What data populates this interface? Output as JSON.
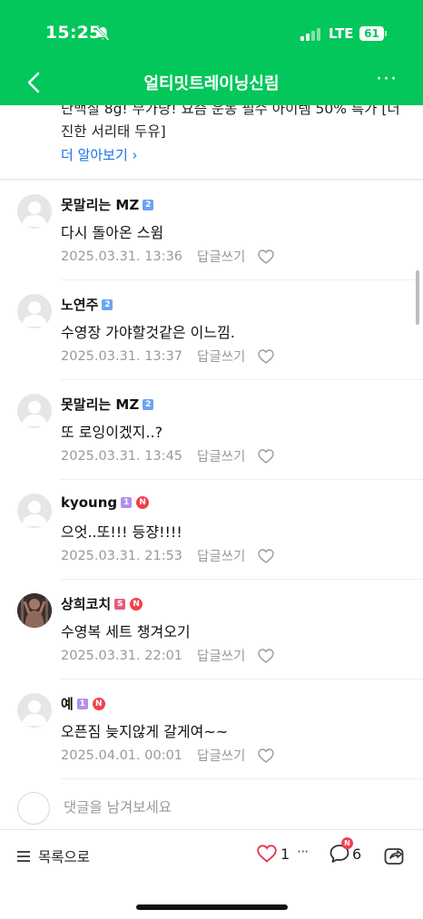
{
  "status_bar": {
    "time": "15:25",
    "network": "LTE",
    "battery": "61"
  },
  "nav": {
    "title": "얼티밋트레이닝신림"
  },
  "ad": {
    "text": "단백질 8g! 무가당! 요즘 운동 필수 아이템 50% 특가 [더 진한 서리태 두유]",
    "link": "더 알아보기 ›"
  },
  "comments": [
    {
      "author": "못말리는 MZ",
      "level": "2",
      "level_color": "#6ba3f5",
      "new": false,
      "text": "다시 돌아온 스윔",
      "date": "2025.03.31. 13:36",
      "reply": "답글쓰기",
      "photo": false
    },
    {
      "author": "노연주",
      "level": "2",
      "level_color": "#6ba3f5",
      "new": false,
      "text": "수영장 가야할것같은 이느낌.",
      "date": "2025.03.31. 13:37",
      "reply": "답글쓰기",
      "photo": false
    },
    {
      "author": "못말리는 MZ",
      "level": "2",
      "level_color": "#6ba3f5",
      "new": false,
      "text": "또 로잉이겠지..?",
      "date": "2025.03.31. 13:45",
      "reply": "답글쓰기",
      "photo": false
    },
    {
      "author": "kyoung",
      "level": "1",
      "level_color": "#b48ef0",
      "new": true,
      "new_label": "N",
      "text": "으엇..또!!! 등쟝!!!!",
      "date": "2025.03.31. 21:53",
      "reply": "답글쓰기",
      "photo": false
    },
    {
      "author": "상희코치",
      "level": "S",
      "level_color": "#e45b78",
      "new": true,
      "new_label": "N",
      "text": "수영복 세트 챙겨오기",
      "date": "2025.03.31. 22:01",
      "reply": "답글쓰기",
      "photo": true
    },
    {
      "author": "예",
      "level": "1",
      "level_color": "#b48ef0",
      "new": true,
      "new_label": "N",
      "text": "오픈짐 늦지않게 갈게여~~",
      "date": "2025.04.01. 00:01",
      "reply": "답글쓰기",
      "photo": false
    }
  ],
  "input": {
    "placeholder": "댓글을 남겨보세요"
  },
  "bottom": {
    "list_label": "목록으로",
    "like_count": "1",
    "more": "···",
    "comment_badge": "N",
    "comment_count": "6"
  },
  "colors": {
    "brand": "#03c75a",
    "link": "#1a73e8",
    "badge_new": "#f0414e",
    "heart": "#e8344e"
  },
  "icons": [
    "bell-off-icon",
    "signal-icon",
    "battery-icon",
    "back-icon",
    "more-icon",
    "avatar-default-icon",
    "heart-outline-icon",
    "list-icon",
    "heart-icon",
    "comment-icon",
    "share-icon"
  ]
}
